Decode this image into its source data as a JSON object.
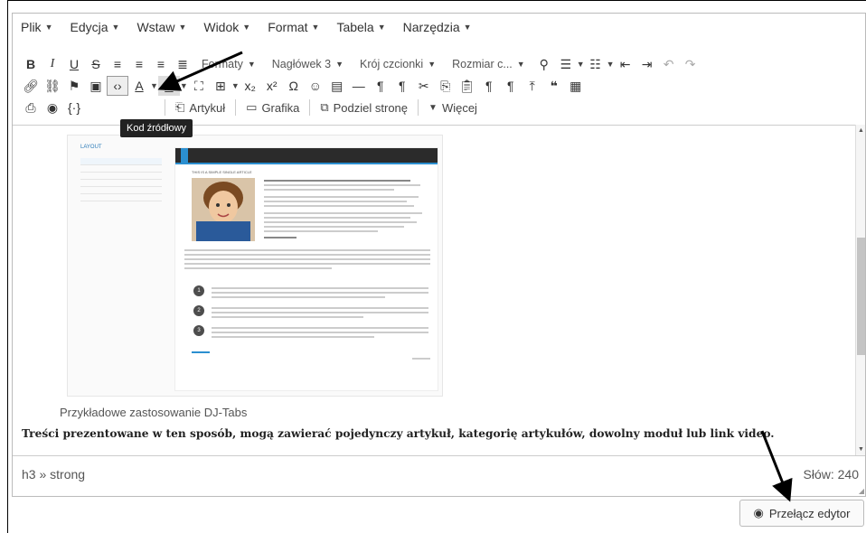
{
  "menubar": {
    "items": [
      {
        "label": "Plik"
      },
      {
        "label": "Edycja"
      },
      {
        "label": "Wstaw"
      },
      {
        "label": "Widok"
      },
      {
        "label": "Format"
      },
      {
        "label": "Tabela"
      },
      {
        "label": "Narzędzia"
      }
    ]
  },
  "toolbar": {
    "row1": {
      "formats_label": "Formaty",
      "heading_label": "Nagłówek 3",
      "font_label": "Krój czcionki",
      "size_label": "Rozmiar c..."
    },
    "row3": {
      "article_label": "Artykuł",
      "image_label": "Grafika",
      "pagebreak_label": "Podziel stronę",
      "more_label": "Więcej"
    },
    "tooltip": "Kod źródłowy"
  },
  "content": {
    "caption": "Przykładowe zastosowanie DJ-Tabs",
    "bold_text": "Treści prezentowane w ten sposób, mogą zawierać pojedynczy artykuł, kategorię artykułów, dowolny moduł lub link video.",
    "thumbnail": {
      "sidebar_title": "LAYOUT",
      "article_title": "THIS IS A SIMPLE SINGLE ARTICLE"
    }
  },
  "statusbar": {
    "path": "h3 » strong",
    "word_count": "Słów: 240"
  },
  "toggle_button": {
    "label": "Przełącz edytor"
  },
  "colors": {
    "accent": "#2b8fd0",
    "tooltip_bg": "#222222"
  }
}
